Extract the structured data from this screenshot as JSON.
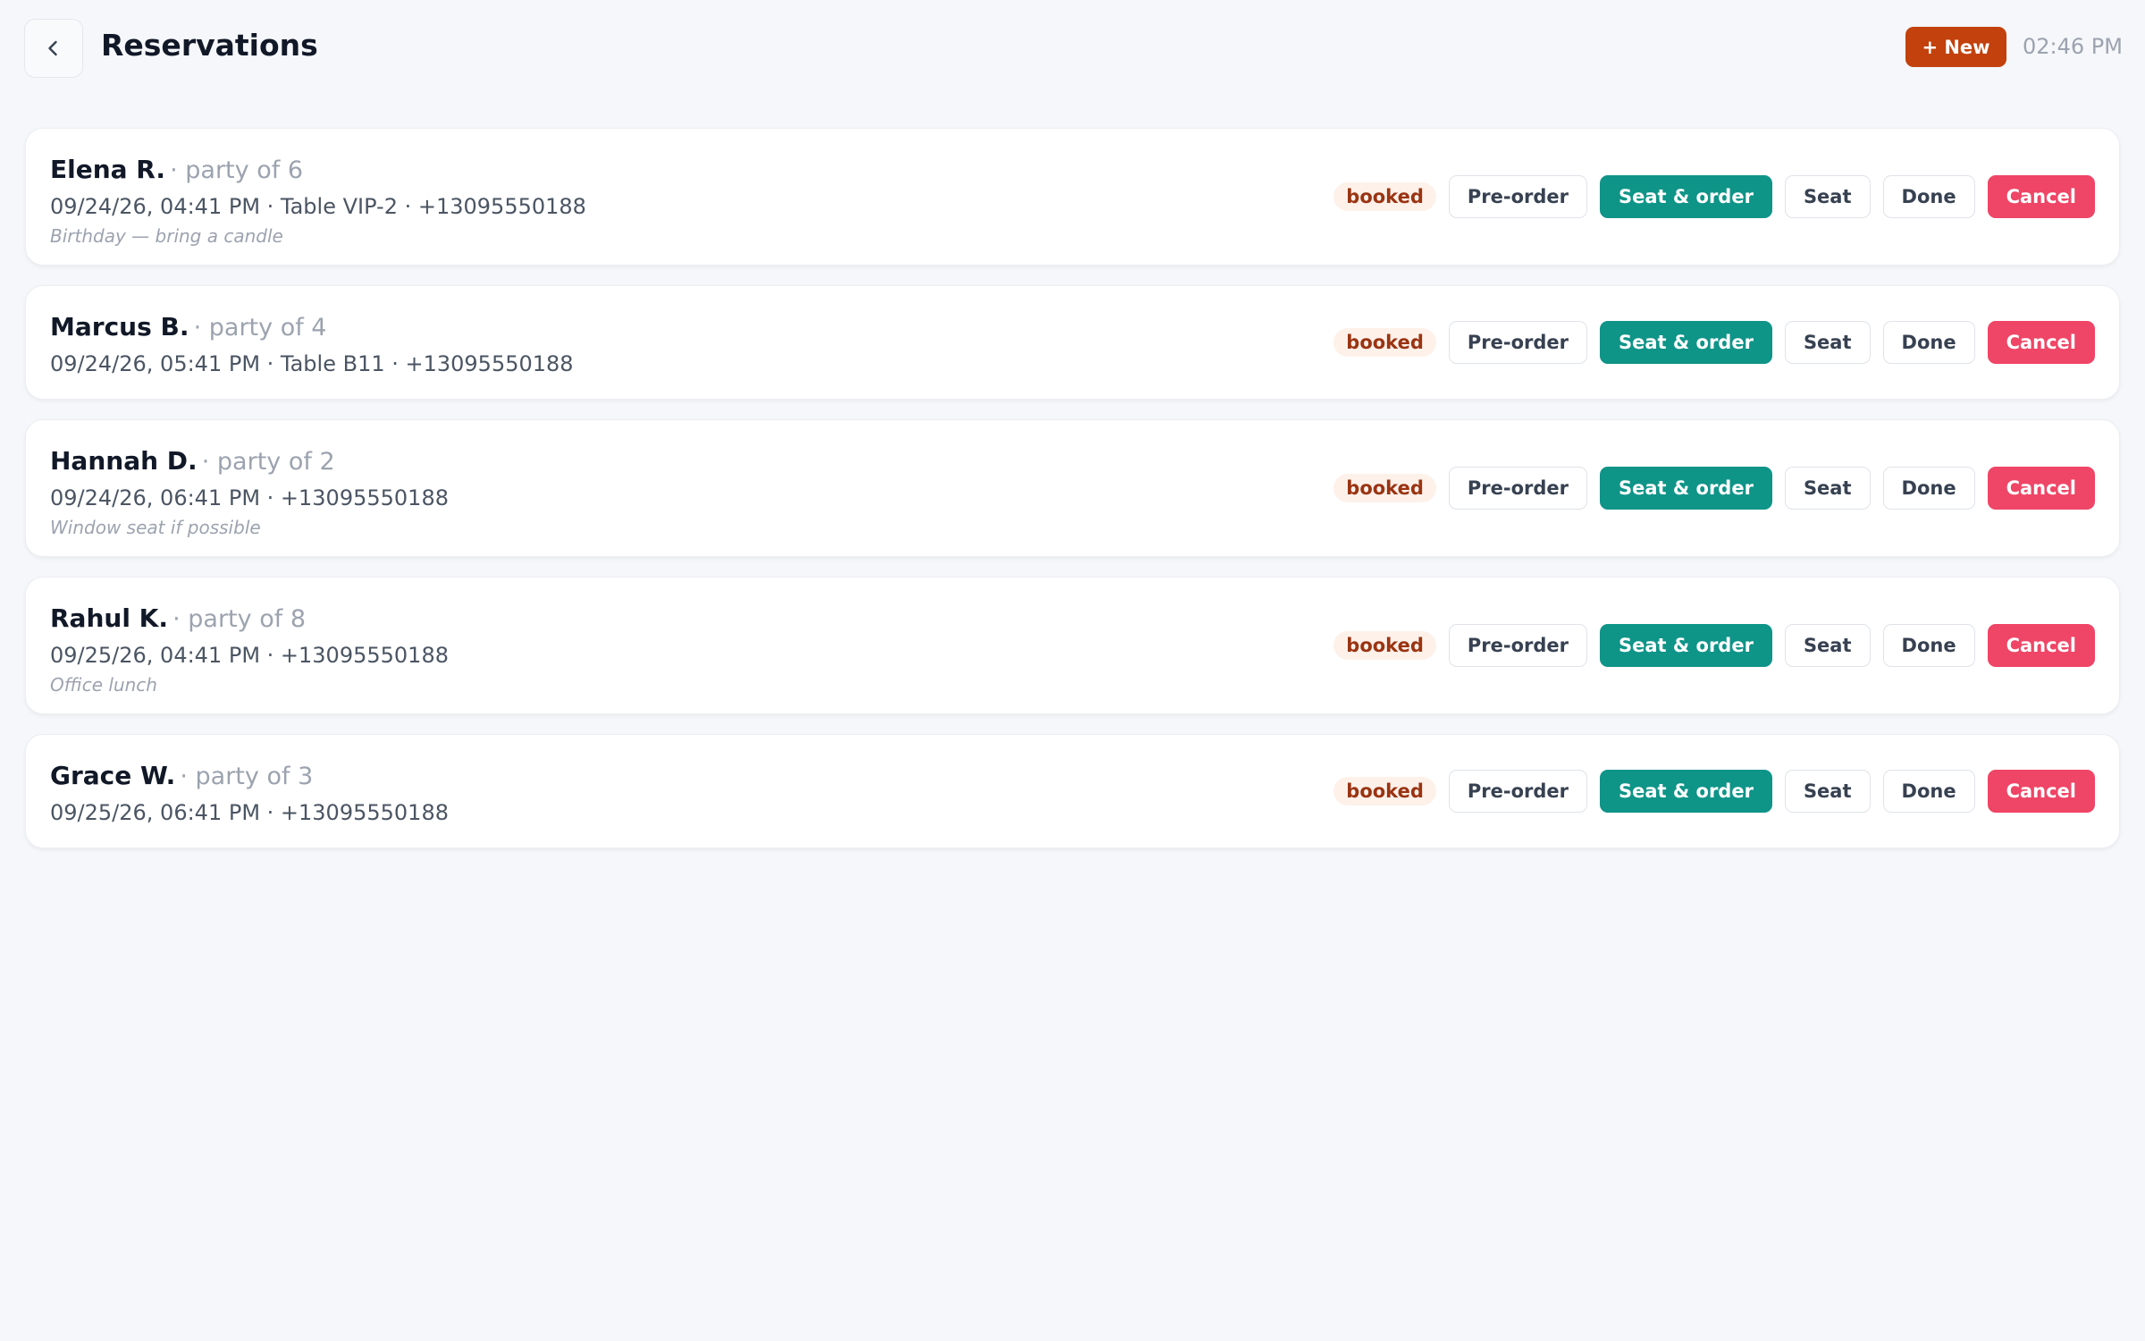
{
  "header": {
    "title": "Reservations",
    "back_icon": "chevron-left-icon",
    "new_label": "+ New",
    "time": "02:46 PM",
    "accent_color": "#c2410c"
  },
  "actions": {
    "preorder_label": "Pre-order",
    "seat_order_label": "Seat & order",
    "seat_label": "Seat",
    "done_label": "Done",
    "cancel_label": "Cancel"
  },
  "colors": {
    "seat_order": "#0f9488",
    "cancel": "#ef4566",
    "badge_text": "#9a3412",
    "badge_bg": "#fdf1ea"
  },
  "reservations": [
    {
      "name": "Elena R.",
      "party": "· party of 6",
      "details": "09/24/26, 04:41 PM · Table VIP-2 · +13095550188",
      "note": "Birthday — bring a candle",
      "status": "booked"
    },
    {
      "name": "Marcus B.",
      "party": "· party of 4",
      "details": "09/24/26, 05:41 PM · Table B11 · +13095550188",
      "note": "",
      "status": "booked"
    },
    {
      "name": "Hannah D.",
      "party": "· party of 2",
      "details": "09/24/26, 06:41 PM · +13095550188",
      "note": "Window seat if possible",
      "status": "booked"
    },
    {
      "name": "Rahul K.",
      "party": "· party of 8",
      "details": "09/25/26, 04:41 PM · +13095550188",
      "note": "Office lunch",
      "status": "booked"
    },
    {
      "name": "Grace W.",
      "party": "· party of 3",
      "details": "09/25/26, 06:41 PM · +13095550188",
      "note": "",
      "status": "booked"
    }
  ]
}
